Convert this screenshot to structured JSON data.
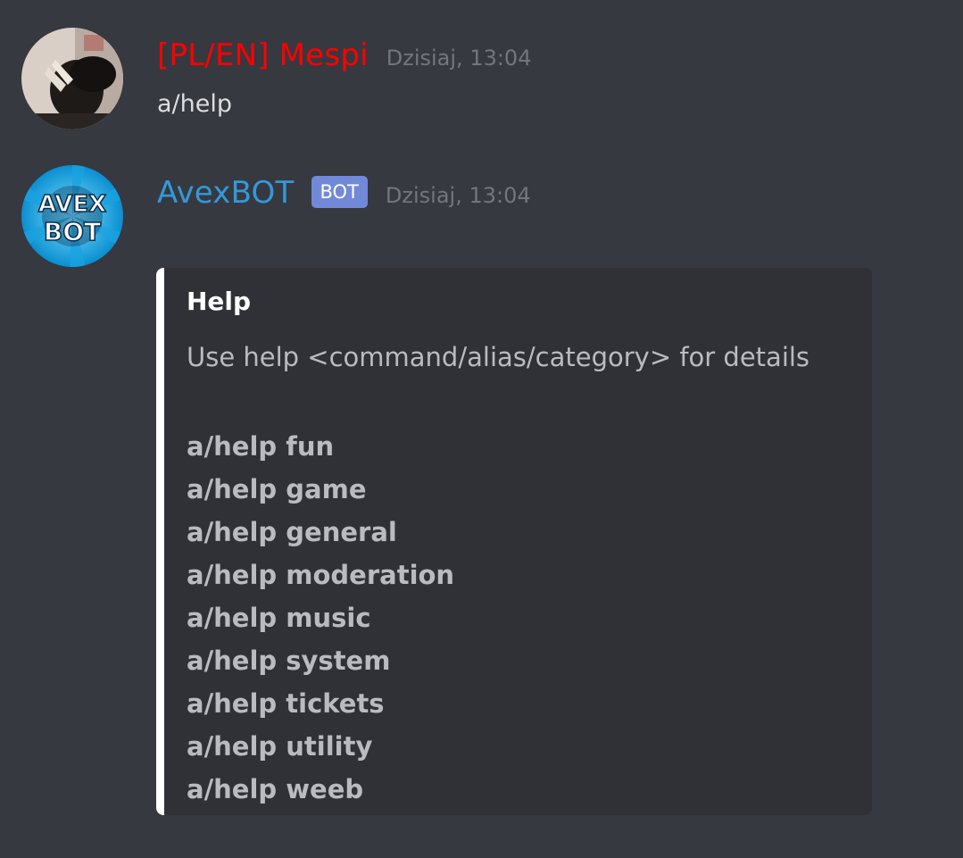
{
  "messages": [
    {
      "username": "[PL/EN] Mespi",
      "username_color": "#ff0000",
      "timestamp": "Dzisiaj, 13:04",
      "content": "a/help"
    },
    {
      "username": "AvexBOT",
      "username_color": "#3498db",
      "bot_tag": "BOT",
      "bot_tag_color": "#7289da",
      "timestamp": "Dzisiaj, 13:04",
      "avatar_text": [
        "AVEX",
        "BOT"
      ],
      "embed": {
        "color": "#ffffff",
        "title": "Help",
        "description": "Use help <command/alias/category> for details",
        "commands": [
          "a/help fun",
          "a/help game",
          "a/help general",
          "a/help moderation",
          "a/help music",
          "a/help system",
          "a/help tickets",
          "a/help utility",
          "a/help weeb"
        ]
      }
    }
  ]
}
